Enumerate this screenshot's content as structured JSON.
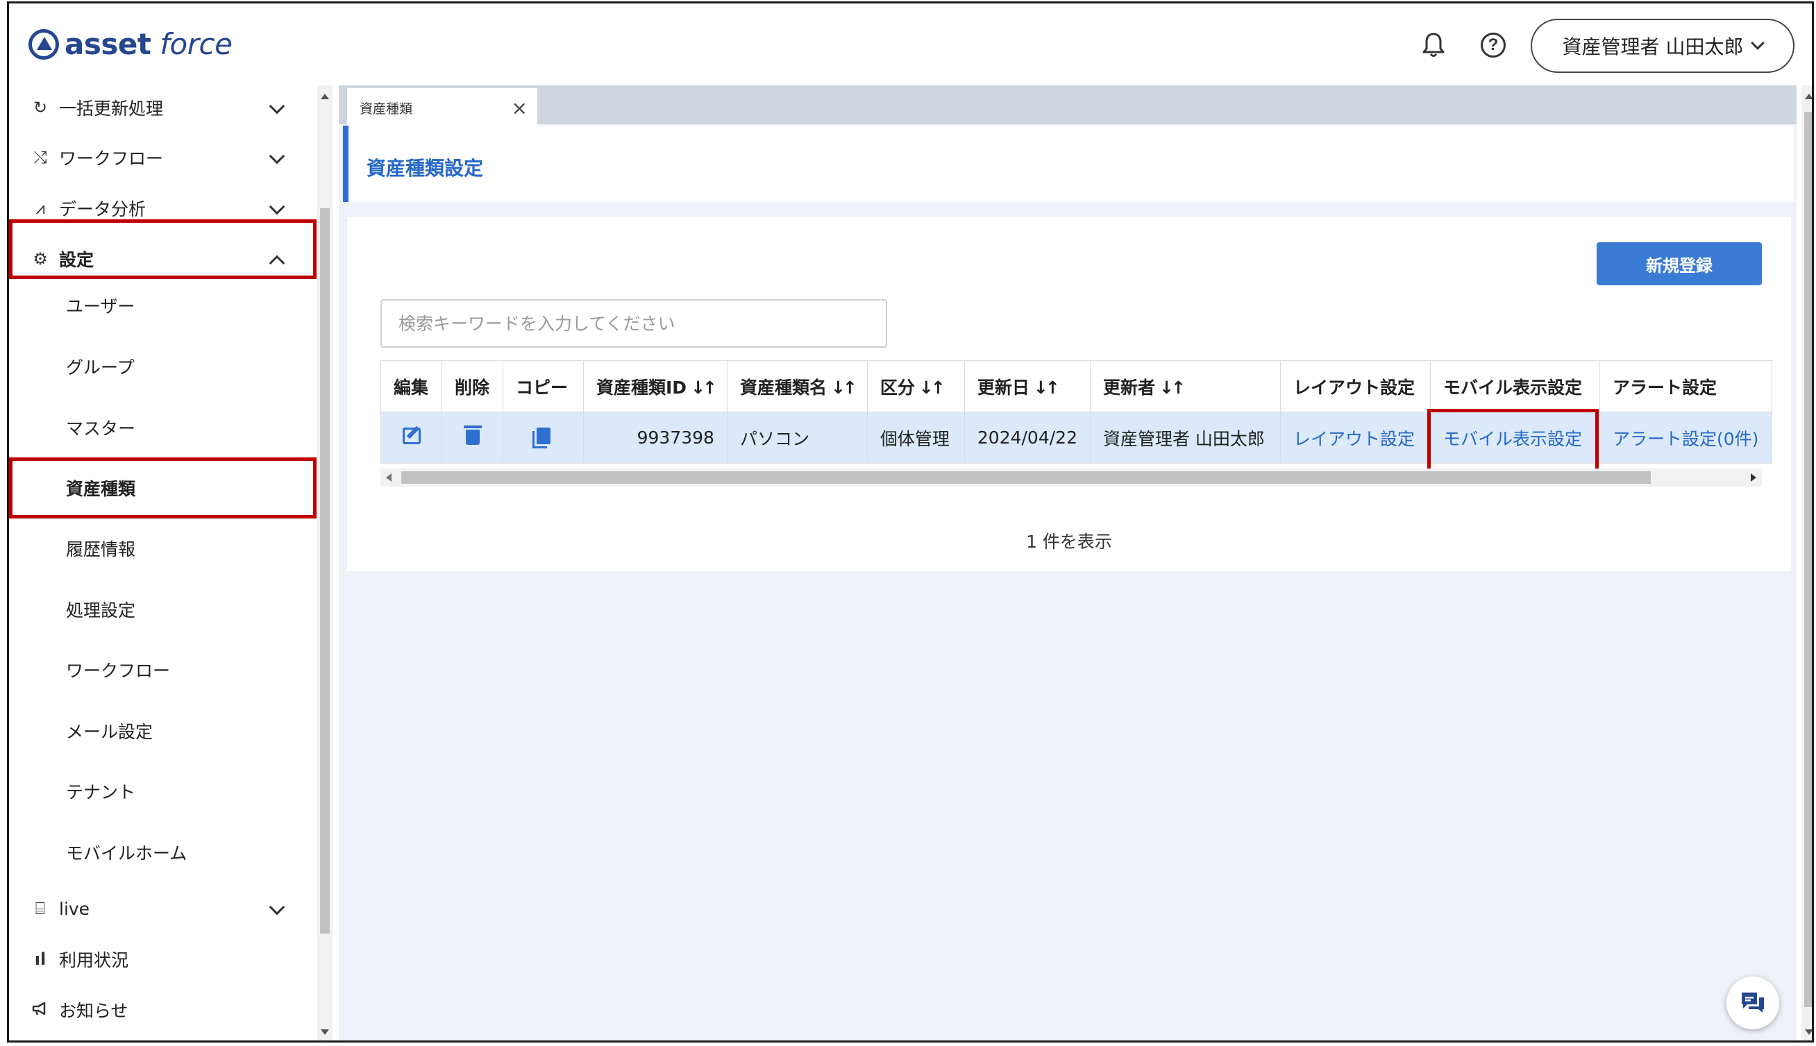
{
  "app": {
    "logo_text_bold": "asset",
    "logo_text_rest": " force"
  },
  "header": {
    "user_name": "資産管理者 山田太郎"
  },
  "sidebar": {
    "items": [
      {
        "label": "一括更新処理",
        "icon": "refresh-icon",
        "glyph": "↻"
      },
      {
        "label": "ワークフロー",
        "icon": "workflow-icon",
        "glyph": "⤭"
      },
      {
        "label": "データ分析",
        "icon": "analytics-icon",
        "glyph": "⩘"
      },
      {
        "label": "設定",
        "icon": "gear-icon",
        "glyph": "⚙"
      }
    ],
    "sub_items": [
      {
        "label": "ユーザー"
      },
      {
        "label": "グループ"
      },
      {
        "label": "マスター"
      },
      {
        "label": "資産種類"
      },
      {
        "label": "履歴情報"
      },
      {
        "label": "処理設定"
      },
      {
        "label": "ワークフロー"
      },
      {
        "label": "メール設定"
      },
      {
        "label": "テナント"
      },
      {
        "label": "モバイルホーム"
      }
    ],
    "bottom_items": [
      {
        "label": "live",
        "icon": "live-icon",
        "glyph": "⌸"
      },
      {
        "label": "利用状況",
        "icon": "usage-chart-icon",
        "glyph": "ıl"
      },
      {
        "label": "お知らせ",
        "icon": "megaphone-icon",
        "glyph": "📢"
      }
    ]
  },
  "tabs": [
    {
      "label": "資産種類"
    }
  ],
  "page": {
    "title": "資産種類設定"
  },
  "toolbar": {
    "new_button": "新規登録"
  },
  "search": {
    "placeholder": "検索キーワードを入力してください",
    "value": ""
  },
  "table": {
    "headers": {
      "edit": "編集",
      "delete": "削除",
      "copy": "コピー",
      "asset_type_id": "資産種類ID",
      "asset_type_name": "資産種類名",
      "category": "区分",
      "updated_at": "更新日",
      "updated_by": "更新者",
      "layout": "レイアウト設定",
      "mobile": "モバイル表示設定",
      "alert": "アラート設定"
    },
    "rows": [
      {
        "asset_type_id": "9937398",
        "asset_type_name": "パソコン",
        "category": "個体管理",
        "updated_at": "2024/04/22",
        "updated_by": "資産管理者 山田太郎",
        "layout_link": "レイアウト設定",
        "mobile_link": "モバイル表示設定",
        "alert_link": "アラート設定(0件)"
      }
    ]
  },
  "footer": {
    "count_text": "1 件を表示"
  },
  "colors": {
    "accent": "#2568c8",
    "highlight_box": "#c00000",
    "row_selected": "#dbe9fb",
    "brand": "#24478f"
  }
}
